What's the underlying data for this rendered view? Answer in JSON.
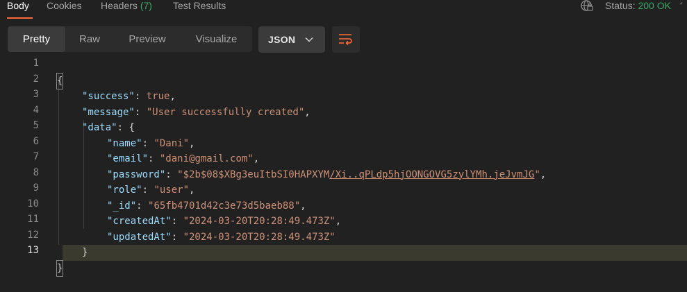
{
  "tabs": [
    {
      "label": "Body",
      "active": true
    },
    {
      "label": "Cookies",
      "active": false
    },
    {
      "label": "Headers",
      "count": "(7)",
      "active": false
    },
    {
      "label": "Test Results",
      "active": false
    }
  ],
  "status": {
    "label": "Status:",
    "value": "200 OK"
  },
  "view_modes": [
    "Pretty",
    "Raw",
    "Preview",
    "Visualize"
  ],
  "active_view_mode": "Pretty",
  "format": {
    "selected": "JSON",
    "icon": "chevron-down-icon"
  },
  "wrap_button": {
    "icon": "wrap-lines-icon"
  },
  "colors": {
    "accent": "#ff6c37",
    "status_ok": "#3aa866",
    "json_key": "#9cdcfe",
    "json_string": "#ce9178"
  },
  "line_numbers": [
    "1",
    "2",
    "3",
    "4",
    "5",
    "6",
    "7",
    "8",
    "9",
    "10",
    "11",
    "12",
    "13"
  ],
  "code": {
    "open_brace": "{",
    "close_brace": "}",
    "success_key": "\"success\"",
    "success_value": "true",
    "message_key": "\"message\"",
    "message_value": "\"User successfully created\"",
    "data_key": "\"data\"",
    "data_open": "{",
    "data_close": "}",
    "fields": [
      {
        "key": "\"name\"",
        "value": "\"Dani\""
      },
      {
        "key": "\"email\"",
        "value": "\"dani@gmail.com\""
      },
      {
        "key": "\"password\"",
        "value_prefix": "\"$2b$08$XBg3euItbSI0HAPXYM",
        "value_link": "/Xi..qPLdp5hjOONGOVG5zylYMh.jeJvmJG",
        "value_suffix": "\""
      },
      {
        "key": "\"role\"",
        "value": "\"user\""
      },
      {
        "key": "\"_id\"",
        "value": "\"65fb4701d42c3e73d5baeb88\""
      },
      {
        "key": "\"createdAt\"",
        "value": "\"2024-03-20T20:28:49.473Z\""
      },
      {
        "key": "\"updatedAt\"",
        "value": "\"2024-03-20T20:28:49.473Z\""
      }
    ]
  }
}
